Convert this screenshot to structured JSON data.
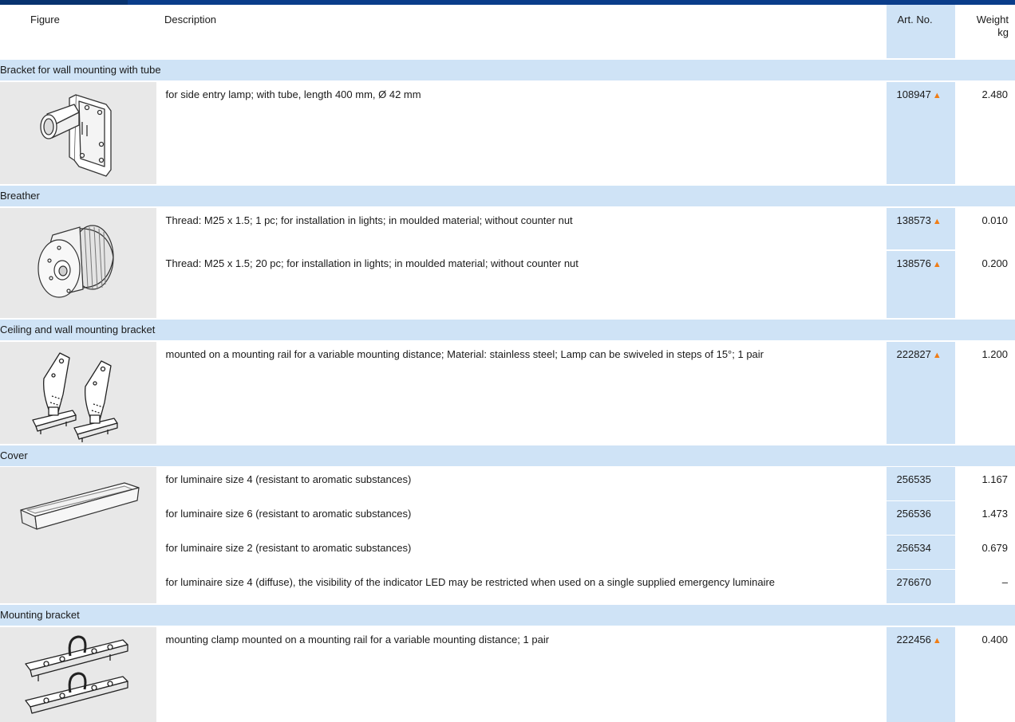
{
  "header": {
    "figure": "Figure",
    "description": "Description",
    "art_no": "Art. No.",
    "weight": "Weight",
    "weight_unit": "kg"
  },
  "groups": [
    {
      "title": "Bracket for wall mounting with tube",
      "icon": "wall-bracket-tube-icon",
      "rows": [
        {
          "description": "for side entry lamp; with tube, length 400 mm, Ø 42 mm",
          "art_no": "108947",
          "marker": "▲",
          "weight": "2.480"
        }
      ]
    },
    {
      "title": "Breather",
      "icon": "breather-icon",
      "rows": [
        {
          "description": "Thread: M25 x 1.5; 1 pc; for installation in lights; in moulded material; without counter nut",
          "art_no": "138573",
          "marker": "▲",
          "weight": "0.010"
        },
        {
          "description": "Thread: M25 x 1.5; 20 pc; for installation in lights; in moulded material; without counter nut",
          "art_no": "138576",
          "marker": "▲",
          "weight": "0.200"
        }
      ]
    },
    {
      "title": "Ceiling and wall mounting bracket",
      "icon": "ceiling-wall-bracket-icon",
      "rows": [
        {
          "description": "mounted on a mounting rail for a variable mounting distance; Material: stainless steel; Lamp can be swiveled in steps of 15°; 1 pair",
          "art_no": "222827",
          "marker": "▲",
          "weight": "1.200"
        }
      ]
    },
    {
      "title": "Cover",
      "icon": "cover-tray-icon",
      "rows": [
        {
          "description": "for luminaire size 4 (resistant to aromatic substances)",
          "art_no": "256535",
          "marker": "",
          "weight": "1.167"
        },
        {
          "description": "for luminaire size 6 (resistant to aromatic substances)",
          "art_no": "256536",
          "marker": "",
          "weight": "1.473"
        },
        {
          "description": "for luminaire size 2 (resistant to aromatic substances)",
          "art_no": "256534",
          "marker": "",
          "weight": "0.679"
        },
        {
          "description": "for luminaire size 4 (diffuse), the visibility of the indicator LED may be restricted when used on a single supplied emergency luminaire",
          "art_no": "276670",
          "marker": "",
          "weight": "–"
        }
      ]
    },
    {
      "title": "Mounting bracket",
      "icon": "mounting-clamp-icon",
      "rows": [
        {
          "description": "mounting clamp mounted on a mounting rail for a variable mounting distance; 1 pair",
          "art_no": "222456",
          "marker": "▲",
          "weight": "0.400"
        }
      ]
    }
  ],
  "colors": {
    "top_bar": "#0a3d8a",
    "group_band": "#cfe3f6",
    "figure_bg": "#e8e8e8",
    "marker": "#f07d16"
  }
}
